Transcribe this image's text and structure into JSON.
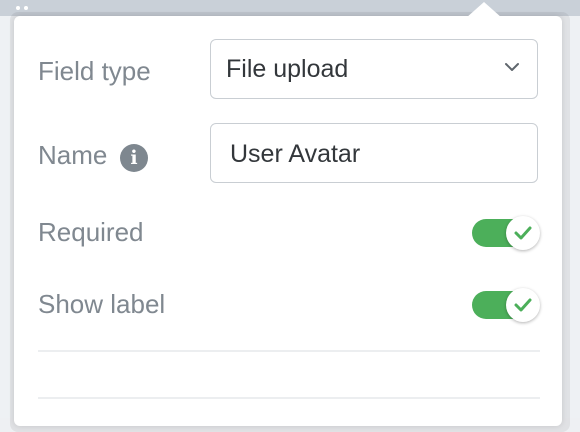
{
  "form": {
    "field_type": {
      "label": "Field type",
      "selected": "File upload"
    },
    "name": {
      "label": "Name",
      "value": "User Avatar",
      "info_icon": "info-circle-icon"
    },
    "required": {
      "label": "Required",
      "enabled": true
    },
    "show_label": {
      "label": "Show label",
      "enabled": true
    }
  },
  "colors": {
    "toggle_on": "#4caf5a",
    "label_text": "#808890",
    "value_text": "#33373b",
    "border": "#c9ced3"
  }
}
